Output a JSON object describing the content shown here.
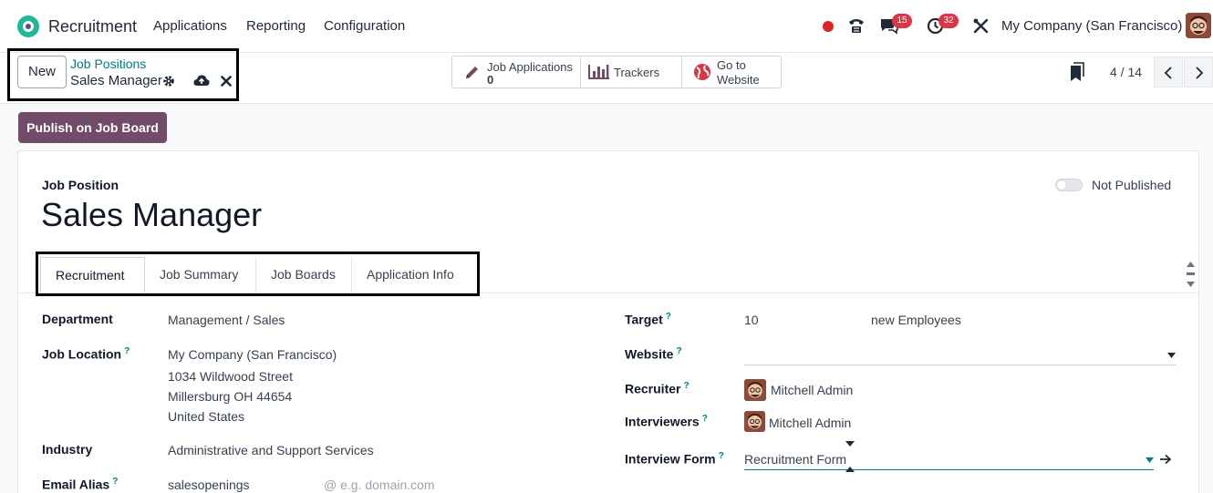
{
  "nav": {
    "app_name": "Recruitment",
    "menus": [
      "Applications",
      "Reporting",
      "Configuration"
    ],
    "messages_badge": "15",
    "activities_badge": "32",
    "company": "My Company (San Francisco)"
  },
  "control": {
    "new_label": "New",
    "breadcrumb_parent": "Job Positions",
    "breadcrumb_current": "Sales Manager",
    "smart_buttons": {
      "job_applications_label": "Job Applications",
      "job_applications_count": "0",
      "trackers_label": "Trackers",
      "website_label_line1": "Go to",
      "website_label_line2": "Website"
    },
    "pager": "4 / 14"
  },
  "status": {
    "publish_label": "Publish on Job Board"
  },
  "form": {
    "record_label": "Job Position",
    "title": "Sales Manager",
    "publish_state": "Not Published",
    "tabs": [
      "Recruitment",
      "Job Summary",
      "Job Boards",
      "Application Info"
    ],
    "left": {
      "department_label": "Department",
      "department": "Management / Sales",
      "location_label": "Job Location",
      "location_lines": [
        "My Company (San Francisco)",
        "1034 Wildwood Street",
        "Millersburg OH 44654",
        "United States"
      ],
      "industry_label": "Industry",
      "industry": "Administrative and Support Services",
      "email_label": "Email Alias",
      "email_value": "salesopenings",
      "email_domain_placeholder": "@ e.g. domain.com"
    },
    "right": {
      "target_label": "Target",
      "target_value": "10",
      "target_unit": "new Employees",
      "website_label": "Website",
      "recruiter_label": "Recruiter",
      "recruiter": "Mitchell Admin",
      "interviewers_label": "Interviewers",
      "interviewer": "Mitchell Admin",
      "interview_form_label": "Interview Form",
      "interview_form": "Recruitment Form"
    },
    "help_mark": "?"
  },
  "colors": {
    "brand": "#714b67",
    "link": "#017e84",
    "badge": "#dc3545"
  }
}
